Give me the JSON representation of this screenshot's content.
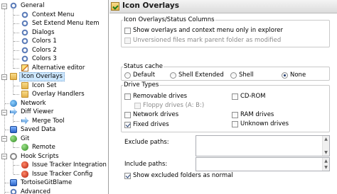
{
  "tree": {
    "items": [
      {
        "label": "General",
        "icon": "gear-icon",
        "level": 0,
        "expander": "-"
      },
      {
        "label": "Context Menu",
        "icon": "gear-icon",
        "level": 1
      },
      {
        "label": "Set Extend Menu Item",
        "icon": "gear-icon",
        "level": 1
      },
      {
        "label": "Dialogs",
        "icon": "gear-icon",
        "level": 1
      },
      {
        "label": "Colors 1",
        "icon": "gear-icon",
        "level": 1
      },
      {
        "label": "Colors 2",
        "icon": "gear-icon",
        "level": 1
      },
      {
        "label": "Colors 3",
        "icon": "gear-icon",
        "level": 1
      },
      {
        "label": "Alternative editor",
        "icon": "pencil-icon",
        "level": 1
      },
      {
        "label": "Icon Overlays",
        "icon": "folder-icon",
        "level": 0,
        "expander": "-",
        "selected": true
      },
      {
        "label": "Icon Set",
        "icon": "folder-icon",
        "level": 1
      },
      {
        "label": "Overlay Handlers",
        "icon": "folder-icon",
        "level": 1
      },
      {
        "label": "Network",
        "icon": "network-icon",
        "level": 0
      },
      {
        "label": "Diff Viewer",
        "icon": "arrow-icon",
        "level": 0,
        "expander": "-"
      },
      {
        "label": "Merge Tool",
        "icon": "arrow-icon",
        "level": 1
      },
      {
        "label": "Saved Data",
        "icon": "disk-icon",
        "level": 0
      },
      {
        "label": "Git",
        "icon": "git-icon",
        "level": 0,
        "expander": "-"
      },
      {
        "label": "Remote",
        "icon": "remote-icon",
        "level": 1
      },
      {
        "label": "Hook Scripts",
        "icon": "hook-icon",
        "level": 0,
        "expander": "-"
      },
      {
        "label": "Issue Tracker Integration",
        "icon": "bug-icon",
        "level": 1
      },
      {
        "label": "Issue Tracker Config",
        "icon": "bug-icon",
        "level": 1
      },
      {
        "label": "TortoiseGitBlame",
        "icon": "blame-icon",
        "level": 0
      },
      {
        "label": "Advanced",
        "icon": "gear-icon",
        "level": 0
      }
    ]
  },
  "header": {
    "title": "Icon Overlays"
  },
  "status_columns": {
    "legend": "Icon Overlays/Status Columns",
    "show_overlays_label": "Show overlays and context menu only in explorer",
    "show_overlays_checked": false,
    "unversioned_label": "Unversioned files mark parent folder as modified",
    "unversioned_checked": false
  },
  "status_cache": {
    "legend": "Status cache",
    "options": [
      "Default",
      "Shell Extended",
      "Shell",
      "None"
    ],
    "selected": "None"
  },
  "drive_types": {
    "legend": "Drive Types",
    "removable": {
      "label": "Removable drives",
      "checked": false
    },
    "floppy": {
      "label": "Floppy drives (A: B:)",
      "checked": false
    },
    "network": {
      "label": "Network drives",
      "checked": false
    },
    "fixed": {
      "label": "Fixed drives",
      "checked": true
    },
    "cdrom": {
      "label": "CD-ROM",
      "checked": false
    },
    "ram": {
      "label": "RAM drives",
      "checked": false
    },
    "unknown": {
      "label": "Unknown drives",
      "checked": false
    }
  },
  "paths": {
    "exclude_label": "Exclude paths:",
    "exclude_value": "",
    "include_label": "Include paths:",
    "include_value": "",
    "show_excluded_label": "Show excluded folders as normal",
    "show_excluded_checked": true
  }
}
